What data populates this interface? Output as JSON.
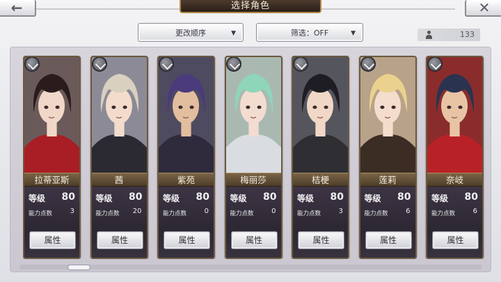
{
  "header": {
    "back_icon": "arrow-left-icon",
    "close_icon": "close-icon",
    "title": "选择角色"
  },
  "controls": {
    "sort_label": "更改顺序",
    "filter_label": "筛选：OFF",
    "dropdown_icon": "triangle-down-icon",
    "character_count": "133",
    "count_icon": "person-icon"
  },
  "cards": [
    {
      "name": "拉蒂亚斯",
      "level_label": "等级",
      "level": "80",
      "points_label": "能力点数",
      "points": "3",
      "button": "属性",
      "hair": "#2a1c1c",
      "outfit": "#a81e24",
      "skin": "#f1d7c8",
      "bg": "#6b5a5a"
    },
    {
      "name": "茜",
      "level_label": "等级",
      "level": "80",
      "points_label": "能力点数",
      "points": "20",
      "button": "属性",
      "hair": "#d9d0c0",
      "outfit": "#2b2a33",
      "skin": "#f3dccb",
      "bg": "#8c8a96"
    },
    {
      "name": "紫苑",
      "level_label": "等级",
      "level": "80",
      "points_label": "能力点数",
      "points": "0",
      "button": "属性",
      "hair": "#4b3a7c",
      "outfit": "#2f2a3c",
      "skin": "#e2bd9e",
      "bg": "#4e4a60"
    },
    {
      "name": "梅丽莎",
      "level_label": "等级",
      "level": "80",
      "points_label": "能力点数",
      "points": "0",
      "button": "属性",
      "hair": "#8fd6b9",
      "outfit": "#d9dde2",
      "skin": "#f2ddd0",
      "bg": "#a9b9b2"
    },
    {
      "name": "桔梗",
      "level_label": "等级",
      "level": "80",
      "points_label": "能力点数",
      "points": "3",
      "button": "属性",
      "hair": "#1f1d24",
      "outfit": "#2e2e33",
      "skin": "#f0d7c6",
      "bg": "#55555d"
    },
    {
      "name": "莲莉",
      "level_label": "等级",
      "level": "80",
      "points_label": "能力点数",
      "points": "6",
      "button": "属性",
      "hair": "#ead28e",
      "outfit": "#3b2d24",
      "skin": "#f4ddcd",
      "bg": "#b8a289"
    },
    {
      "name": "奈岐",
      "level_label": "等级",
      "level": "80",
      "points_label": "能力点数",
      "points": "6",
      "button": "属性",
      "hair": "#2a3350",
      "outfit": "#b82226",
      "skin": "#e8c4a5",
      "bg": "#8a2c2c"
    }
  ]
}
